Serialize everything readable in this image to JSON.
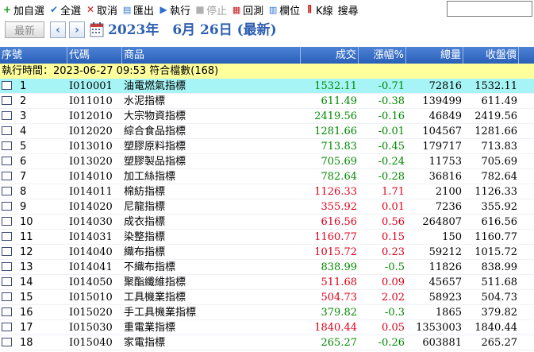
{
  "toolbar": {
    "add_fav": "加自選",
    "select_all": "全選",
    "cancel": "取消",
    "export": "匯出",
    "execute": "執行",
    "stop": "停止",
    "backtest": "回測",
    "columns": "欄位",
    "kline": "K線",
    "search_label": "搜尋",
    "search_value": ""
  },
  "datebar": {
    "latest_button": "最新",
    "date_text": "2023年　6月 26日 (最新)"
  },
  "grid": {
    "columns": [
      "序號",
      "代碼",
      "商品",
      "成交",
      "漲幅%",
      "總量",
      "收盤價"
    ],
    "info": "執行時間：2023-06-27 09:53 符合檔數(168)",
    "rows": [
      {
        "idx": "1",
        "code": "I010001",
        "name": "油電燃氣指標",
        "price": "1532.11",
        "chg": "-0.71",
        "vol": "72816",
        "close": "1532.11"
      },
      {
        "idx": "2",
        "code": "I011010",
        "name": "水泥指標",
        "price": "611.49",
        "chg": "-0.38",
        "vol": "139499",
        "close": "611.49"
      },
      {
        "idx": "3",
        "code": "I012010",
        "name": "大宗物資指標",
        "price": "2419.56",
        "chg": "-0.16",
        "vol": "46849",
        "close": "2419.56"
      },
      {
        "idx": "4",
        "code": "I012020",
        "name": "綜合食品指標",
        "price": "1281.66",
        "chg": "-0.01",
        "vol": "104567",
        "close": "1281.66"
      },
      {
        "idx": "5",
        "code": "I013010",
        "name": "塑膠原料指標",
        "price": "713.83",
        "chg": "-0.45",
        "vol": "179717",
        "close": "713.83"
      },
      {
        "idx": "6",
        "code": "I013020",
        "name": "塑膠製品指標",
        "price": "705.69",
        "chg": "-0.24",
        "vol": "11753",
        "close": "705.69"
      },
      {
        "idx": "7",
        "code": "I014010",
        "name": "加工絲指標",
        "price": "782.64",
        "chg": "-0.28",
        "vol": "36816",
        "close": "782.64"
      },
      {
        "idx": "8",
        "code": "I014011",
        "name": "棉紡指標",
        "price": "1126.33",
        "chg": "1.71",
        "vol": "2100",
        "close": "1126.33"
      },
      {
        "idx": "9",
        "code": "I014020",
        "name": "尼龍指標",
        "price": "355.92",
        "chg": "0.01",
        "vol": "7236",
        "close": "355.92"
      },
      {
        "idx": "10",
        "code": "I014030",
        "name": "成衣指標",
        "price": "616.56",
        "chg": "0.56",
        "vol": "264807",
        "close": "616.56"
      },
      {
        "idx": "11",
        "code": "I014031",
        "name": "染整指標",
        "price": "1160.77",
        "chg": "0.15",
        "vol": "150",
        "close": "1160.77"
      },
      {
        "idx": "12",
        "code": "I014040",
        "name": "織布指標",
        "price": "1015.72",
        "chg": "0.23",
        "vol": "59212",
        "close": "1015.72"
      },
      {
        "idx": "13",
        "code": "I014041",
        "name": "不織布指標",
        "price": "838.99",
        "chg": "-0.5",
        "vol": "11826",
        "close": "838.99"
      },
      {
        "idx": "14",
        "code": "I014050",
        "name": "聚酯纖維指標",
        "price": "511.68",
        "chg": "0.09",
        "vol": "45657",
        "close": "511.68"
      },
      {
        "idx": "15",
        "code": "I015010",
        "name": "工具機業指標",
        "price": "504.73",
        "chg": "2.02",
        "vol": "58923",
        "close": "504.73"
      },
      {
        "idx": "16",
        "code": "I015020",
        "name": "手工具機業指標",
        "price": "379.82",
        "chg": "-0.3",
        "vol": "1865",
        "close": "379.82"
      },
      {
        "idx": "17",
        "code": "I015030",
        "name": "重電業指標",
        "price": "1840.44",
        "chg": "0.05",
        "vol": "1353003",
        "close": "1840.44"
      },
      {
        "idx": "18",
        "code": "I015040",
        "name": "家電指標",
        "price": "265.27",
        "chg": "-0.26",
        "vol": "603881",
        "close": "265.27"
      }
    ]
  },
  "colors": {
    "up": "#e0001b",
    "down": "#008a00",
    "header": "#2a5fb8",
    "selected_row": "#a6f4f5",
    "info_bar": "#ffff9c"
  }
}
